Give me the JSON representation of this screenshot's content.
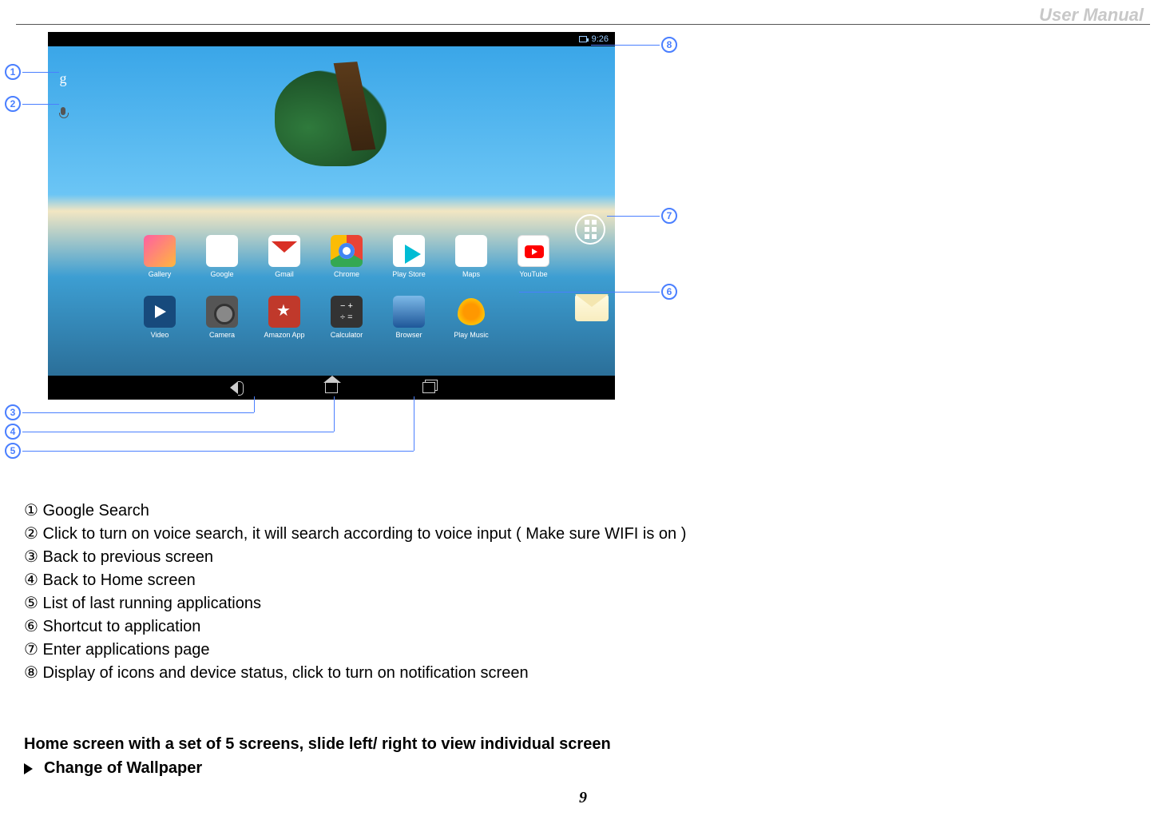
{
  "header": "User Manual",
  "page_number": "9",
  "status": {
    "time": "9:26"
  },
  "apps": {
    "row1": [
      "Gallery",
      "Google",
      "Gmail",
      "Chrome",
      "Play Store",
      "Maps",
      "YouTube"
    ],
    "row2": [
      "Video",
      "Camera",
      "Amazon App",
      "Calculator",
      "Browser",
      "Play Music"
    ]
  },
  "callouts": {
    "c1": "①",
    "c2": "②",
    "c3": "③",
    "c4": "④",
    "c5": "⑤",
    "c6": "⑥",
    "c7": "⑦",
    "c8": "⑧"
  },
  "badge": {
    "b1": "1",
    "b2": "2",
    "b3": "3",
    "b4": "4",
    "b5": "5",
    "b6": "6",
    "b7": "7",
    "b8": "8"
  },
  "legend": {
    "l1": "Google Search",
    "l2": "Click to turn on voice search, it will search according to voice input ( Make sure WIFI is on )",
    "l3": "Back to previous screen",
    "l4": "Back to Home screen",
    "l5": "List of last running applications",
    "l6": "Shortcut to application",
    "l7": "Enter applications page",
    "l8": "Display of icons and device status, click to turn on notification screen"
  },
  "subheading": "Home screen with a set of 5 screens, slide left/ right to view individual screen",
  "bullet": "Change of Wallpaper"
}
